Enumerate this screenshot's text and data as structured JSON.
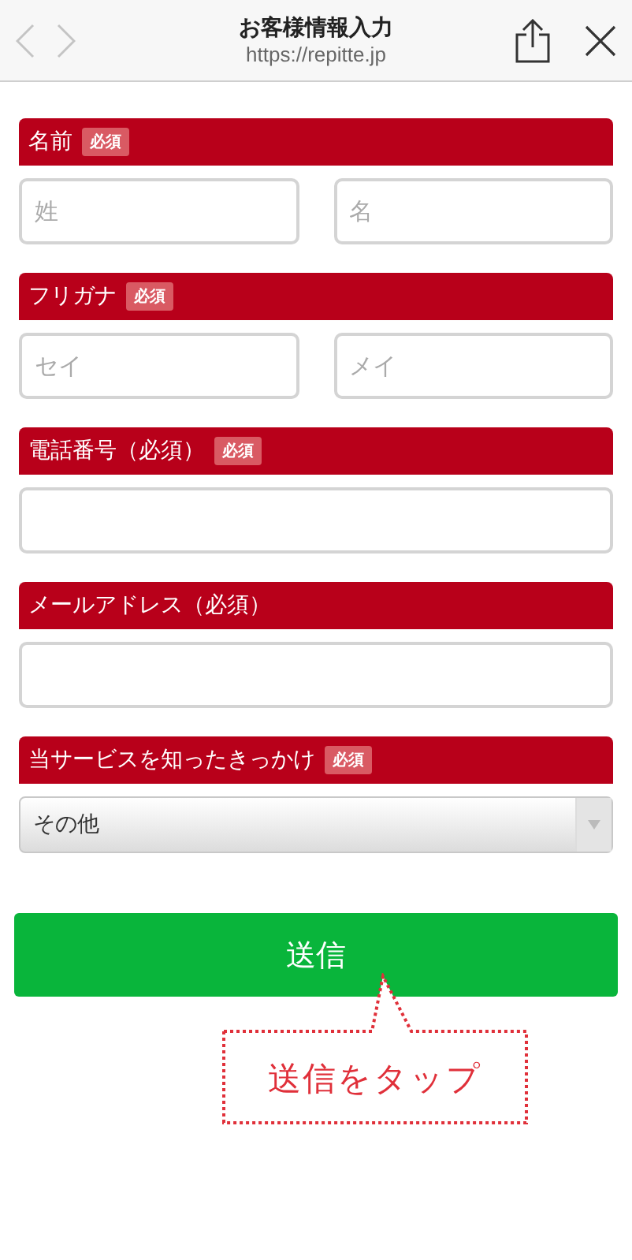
{
  "header": {
    "title": "お客様情報入力",
    "url": "https://repitte.jp",
    "back_disabled": true,
    "forward_disabled": true
  },
  "sections": [
    {
      "label": "名前",
      "badge": "必須",
      "field": {
        "kind": "pair",
        "placeholders": [
          "姓",
          "名"
        ]
      }
    },
    {
      "label": "フリガナ",
      "badge": "必須",
      "field": {
        "kind": "pair",
        "placeholders": [
          "セイ",
          "メイ"
        ]
      }
    },
    {
      "label": "電話番号（必須）",
      "badge": "必須",
      "field": {
        "kind": "text"
      }
    },
    {
      "label": "メールアドレス（必須）",
      "field": {
        "kind": "text"
      }
    },
    {
      "label": "当サービスを知ったきっかけ",
      "badge": "必須",
      "field": {
        "kind": "select",
        "value": "その他"
      }
    }
  ],
  "submit": {
    "label": "送信"
  },
  "callout": {
    "text": "送信をタップ"
  }
}
